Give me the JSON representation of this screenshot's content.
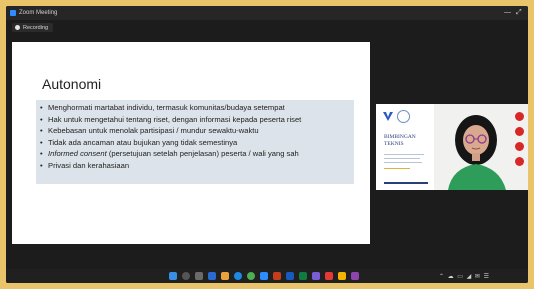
{
  "window": {
    "title": "Zoom Meeting",
    "minimize_glyph": "—",
    "maximize_glyph": "⤢"
  },
  "recording": {
    "label": "Recording"
  },
  "slide": {
    "title": "Autonomi",
    "bullets": [
      "Menghormati martabat individu, termasuk komunitas/budaya setempat",
      "Hak untuk mengetahui tentang riset, dengan informasi kepada peserta riset",
      "Kebebasan untuk menolak partisipasi / mundur sewaktu-waktu",
      "Tidak ada ancaman atau bujukan yang tidak semestinya",
      "(persetujuan setelah penjelasan) peserta / wali yang sah",
      "Privasi dan kerahasiaan"
    ],
    "bullet5_italic": "Informed consent",
    "bullet_glyph": "•"
  },
  "video": {
    "poster_title": "BIMBINGAN TEKNIS"
  },
  "taskbar": {
    "tray_glyphs": "⌃ ☁ ▭ ◢ ✉ ☰",
    "time": "",
    "date": ""
  },
  "colors": {
    "frame": "#e9c46a",
    "zoom_blue": "#2d8cff",
    "slide_bg": "#ffffff",
    "bullet_bg": "#dde3ea"
  }
}
